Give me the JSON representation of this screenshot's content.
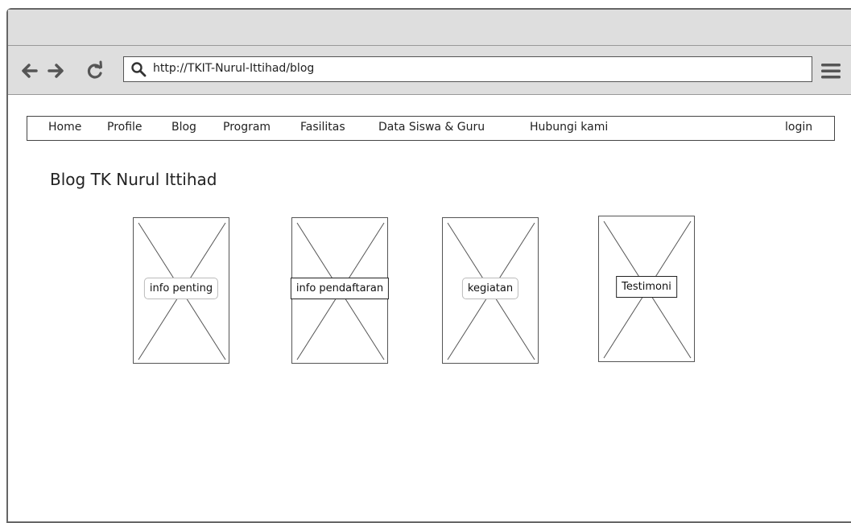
{
  "browser": {
    "url": "http://TKIT-Nurul-Ittihad/blog",
    "back_icon": "back-arrow-icon",
    "forward_icon": "forward-arrow-icon",
    "reload_icon": "reload-icon",
    "search_icon": "search-icon",
    "menu_icon": "hamburger-menu-icon"
  },
  "nav": {
    "items": [
      "Home",
      "Profile",
      "Blog",
      "Program",
      "Fasilitas",
      "Data Siswa & Guru",
      "Hubungi kami"
    ],
    "login": "login"
  },
  "page": {
    "title": "Blog TK Nurul Ittihad"
  },
  "cards": [
    {
      "label": "info penting"
    },
    {
      "label": "info pendaftaran"
    },
    {
      "label": "kegiatan"
    },
    {
      "label": "Testimoni"
    }
  ]
}
